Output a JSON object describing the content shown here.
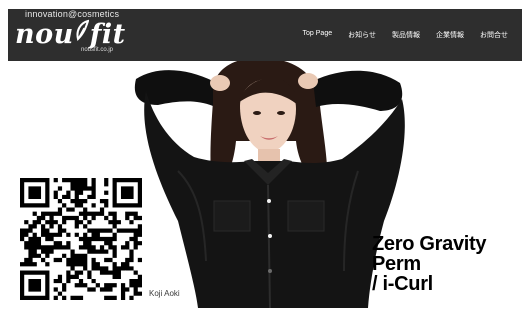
{
  "header": {
    "tagline": "innovation@cosmetics",
    "logo_left": "nou",
    "logo_right": "fit",
    "domain": "nousfit.co.jp"
  },
  "nav": {
    "items": [
      {
        "label": "Top Page"
      },
      {
        "label": "お知らせ"
      },
      {
        "label": "製品情報"
      },
      {
        "label": "企業情報"
      },
      {
        "label": "お問合せ"
      }
    ]
  },
  "hero": {
    "headline_line1": "Zero Gravity",
    "headline_line2": "Perm",
    "headline_line3": "/ i-Curl",
    "photo_credit": "Koji Aoki"
  },
  "colors": {
    "header_bg": "#2e2e2e",
    "nav_text": "#ffffff",
    "headline": "#000000"
  }
}
